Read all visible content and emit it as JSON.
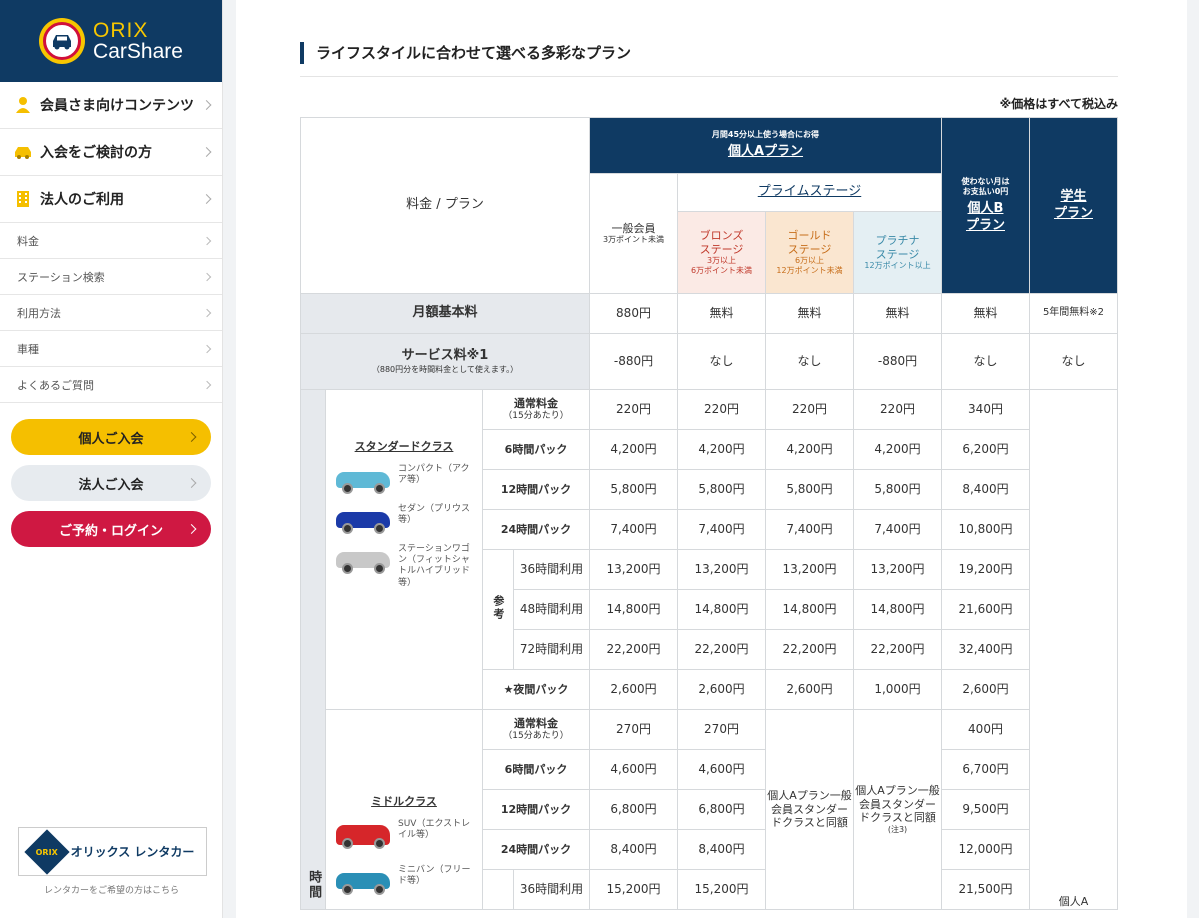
{
  "brand": {
    "line1": "ORIX",
    "line2": "CarShare"
  },
  "sidebar": {
    "main_items": [
      {
        "label": "会員さま向けコンテンツ",
        "icon": "member-icon"
      },
      {
        "label": "入会をご検討の方",
        "icon": "car-icon"
      },
      {
        "label": "法人のご利用",
        "icon": "building-icon"
      }
    ],
    "sub_items": [
      "料金",
      "ステーション検索",
      "利用方法",
      "車種",
      "よくあるご質問"
    ],
    "buttons": {
      "individual": "個人ご入会",
      "corporate": "法人ご入会",
      "login": "ご予約・ログイン"
    },
    "rental": {
      "logo": "ORIX",
      "name": "オリックス レンタカー",
      "note": "レンタカーをご希望の方はこちら"
    }
  },
  "main": {
    "title": "ライフスタイルに合わせて選べる多彩なプラン",
    "tax_note": "※価格はすべて税込み",
    "header": {
      "plan_label": "料金 / プラン",
      "planA_tagline": "月間45分以上使う場合にお得",
      "planA_name": "個人Aプラン",
      "general_name": "一般会員",
      "general_cond": "3万ポイント未満",
      "prime": "プライムステージ",
      "bronze_name": "ブロンズ",
      "bronze_stage": "ステージ",
      "bronze_cond1": "3万以上",
      "bronze_cond2": "6万ポイント未満",
      "gold_name": "ゴールド",
      "gold_stage": "ステージ",
      "gold_cond1": "6万以上",
      "gold_cond2": "12万ポイント未満",
      "plat_name": "プラチナ",
      "plat_stage": "ステージ",
      "plat_cond": "12万ポイント以上",
      "planB_tag1": "使わない月は",
      "planB_tag2": "お支払い0円",
      "planB_name1": "個人B",
      "planB_name2": "プラン",
      "student_name1": "学生",
      "student_name2": "プラン"
    },
    "monthly": {
      "label": "月額基本料",
      "values": [
        "880円",
        "無料",
        "無料",
        "無料",
        "無料",
        "5年間無料※2"
      ]
    },
    "service": {
      "label": "サービス料※1",
      "note": "（880円分を時間料金として使えます。）",
      "values": [
        "-880円",
        "なし",
        "なし",
        "-880円",
        "なし",
        "なし"
      ]
    },
    "section_label": "時間",
    "standard": {
      "title": "スタンダードクラス",
      "cars": [
        {
          "caption": "コンパクト（アクア等）",
          "color": "#5fb9d6"
        },
        {
          "caption": "セダン（プリウス等）",
          "color": "#1b3aa8"
        },
        {
          "caption": "ステーションワゴン（フィットシャトルハイブリッド等）",
          "color": "#c8c8c8"
        }
      ],
      "ref_label": "参考",
      "rows": [
        {
          "label": "通常料金",
          "sub": "（15分あたり）",
          "values": [
            "220円",
            "220円",
            "220円",
            "220円",
            "340円"
          ]
        },
        {
          "label": "6時間パック",
          "values": [
            "4,200円",
            "4,200円",
            "4,200円",
            "4,200円",
            "6,200円"
          ]
        },
        {
          "label": "12時間パック",
          "values": [
            "5,800円",
            "5,800円",
            "5,800円",
            "5,800円",
            "8,400円"
          ]
        },
        {
          "label": "24時間パック",
          "values": [
            "7,400円",
            "7,400円",
            "7,400円",
            "7,400円",
            "10,800円"
          ]
        },
        {
          "label": "36時間利用",
          "values": [
            "13,200円",
            "13,200円",
            "13,200円",
            "13,200円",
            "19,200円"
          ]
        },
        {
          "label": "48時間利用",
          "values": [
            "14,800円",
            "14,800円",
            "14,800円",
            "14,800円",
            "21,600円"
          ]
        },
        {
          "label": "72時間利用",
          "values": [
            "22,200円",
            "22,200円",
            "22,200円",
            "22,200円",
            "32,400円"
          ]
        },
        {
          "label": "★夜間パック",
          "values": [
            "2,600円",
            "2,600円",
            "2,600円",
            "1,000円",
            "2,600円"
          ]
        }
      ]
    },
    "middle": {
      "title": "ミドルクラス",
      "cars": [
        {
          "caption": "SUV（エクストレイル等）",
          "color": "#d6262a"
        },
        {
          "caption": "ミニバン（フリード等）",
          "color": "#2a8fb6"
        }
      ],
      "rows": [
        {
          "label": "通常料金",
          "sub": "（15分あたり）",
          "values": [
            "270円",
            "270円",
            "400円"
          ]
        },
        {
          "label": "6時間パック",
          "values": [
            "4,600円",
            "4,600円",
            "6,700円"
          ]
        },
        {
          "label": "12時間パック",
          "values": [
            "6,800円",
            "6,800円",
            "9,500円"
          ]
        },
        {
          "label": "24時間パック",
          "values": [
            "8,400円",
            "8,400円",
            "12,000円"
          ]
        },
        {
          "label": "36時間利用",
          "values": [
            "15,200円",
            "15,200円",
            "21,500円"
          ]
        }
      ],
      "gold_note": "個人Aプラン一般会員スタンダードクラスと同額",
      "plat_note": "個人Aプラン一般会員スタンダードクラスと同額",
      "plat_note_sub": "(注3)",
      "student_note": "個人A"
    }
  }
}
